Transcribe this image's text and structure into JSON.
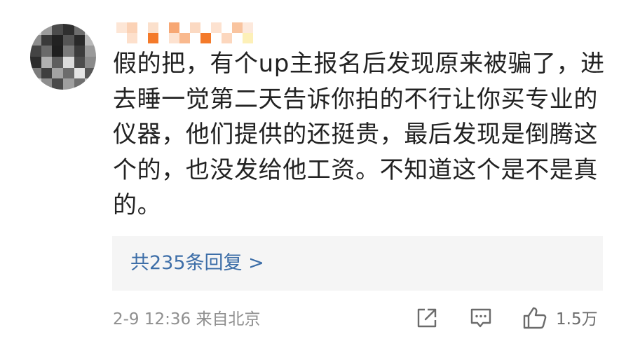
{
  "comment": {
    "body": "假的把，有个up主报名后发现原来被骗了，进去睡一觉第二天告诉你拍的不行让你买专业的仪器，他们提供的还挺贵，最后发现是倒腾这个的，也没发给他工资。不知道这个是不是真的。",
    "replies_label": "共235条回复 >",
    "time": "2-9 12:36",
    "source": "来自北京",
    "like_count": "1.5万"
  },
  "icons": {
    "repost": "share-icon",
    "comment": "comment-icon",
    "like": "thumbs-up-icon"
  },
  "colors": {
    "text": "#222222",
    "link": "#3d6ea8",
    "meta": "#8f8f8f",
    "reply_bg": "#f5f5f5",
    "username_orange": "#f47a2a"
  }
}
